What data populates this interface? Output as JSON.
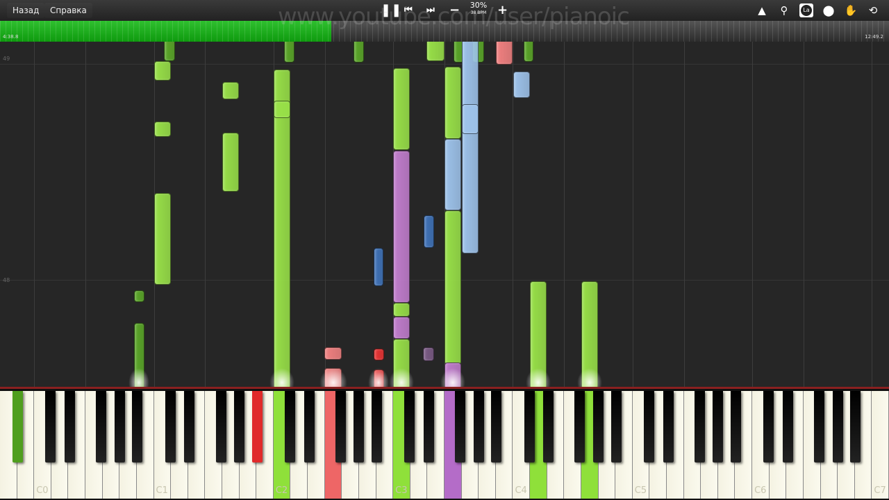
{
  "toolbar": {
    "back_label": "Назад",
    "help_label": "Справка",
    "speed_percent": "30%",
    "tempo": "38 BPM",
    "icons": [
      "pause-icon",
      "skip-back-icon",
      "skip-forward-icon",
      "minus-icon",
      "plus-icon",
      "metronome-icon",
      "search-icon",
      "label-icon",
      "location-pin-icon",
      "hand-icon",
      "loop-icon"
    ],
    "label_icon_text": "La"
  },
  "watermark": "www.youtube.com/user/pianoic",
  "progress": {
    "elapsed": "4:38.8",
    "total": "12:49.2",
    "fraction": 0.373,
    "color": "#1aa01a"
  },
  "roll": {
    "measure_labels": [
      "49",
      "48"
    ]
  },
  "keyboard": {
    "octave_labels": [
      "C0",
      "C1",
      "C2",
      "C3",
      "C4",
      "C5",
      "C6",
      "C7"
    ],
    "pressed_keys": [
      {
        "note": "A#0",
        "color": "#4f9e1e"
      },
      {
        "note": "C2",
        "color": "#8fe03a"
      },
      {
        "note": "F2",
        "color": "#ee6666"
      },
      {
        "note": "A#2",
        "color": "#e02a2a"
      },
      {
        "note": "C3",
        "color": "#8fe03a"
      },
      {
        "note": "F3",
        "color": "#b46cc8"
      },
      {
        "note": "D4",
        "color": "#8fe03a"
      },
      {
        "note": "G4",
        "color": "#8fe03a"
      }
    ]
  }
}
